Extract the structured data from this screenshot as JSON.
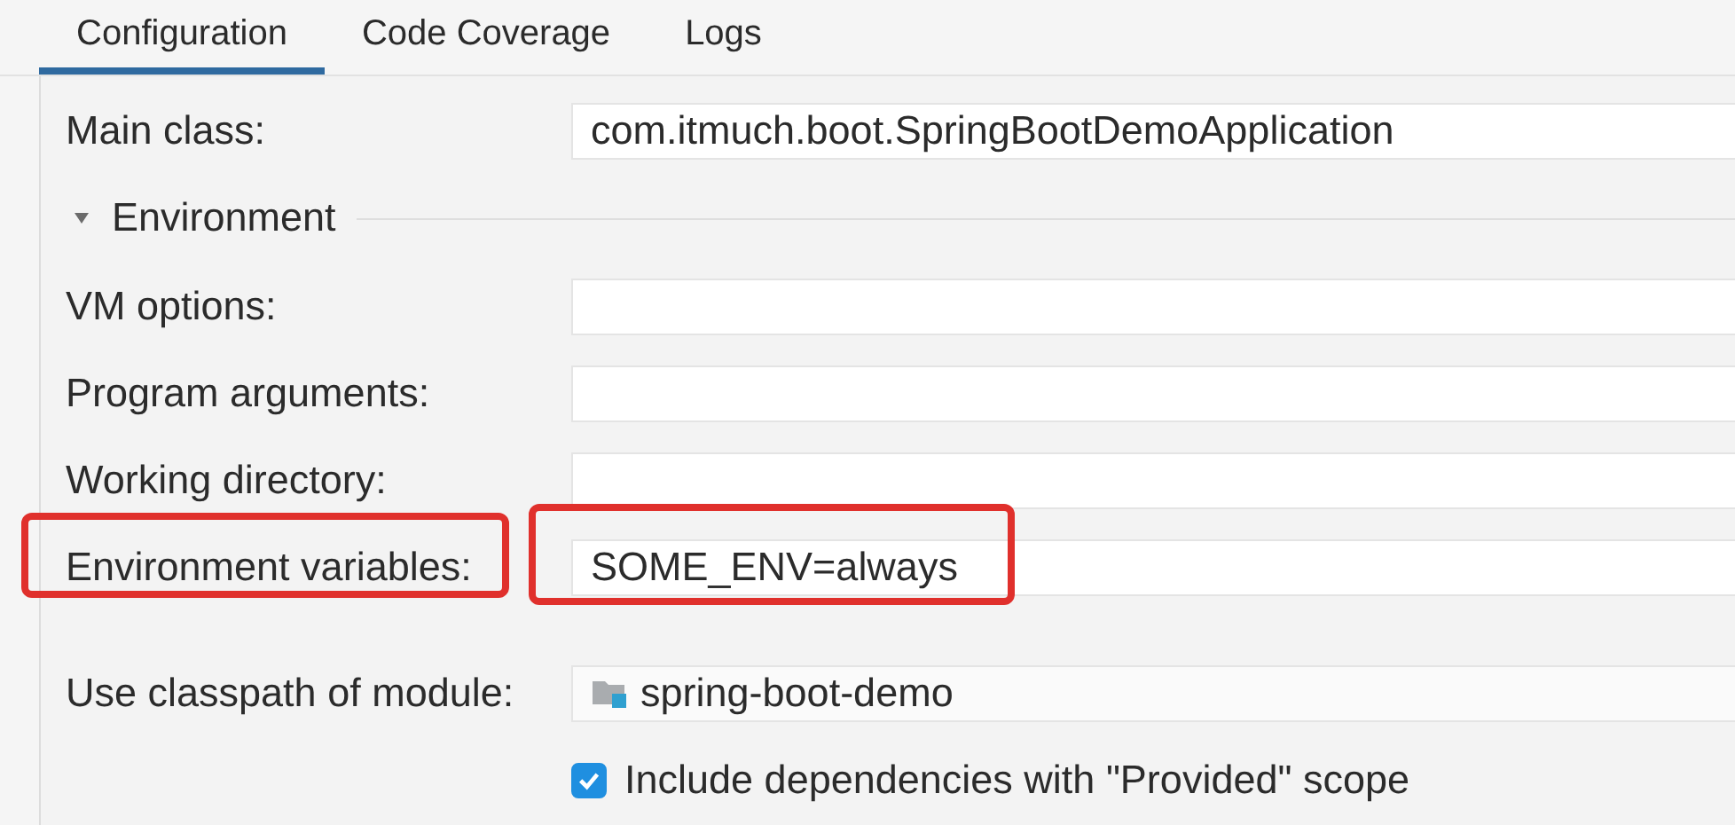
{
  "tabs": [
    {
      "label": "Configuration",
      "selected": true
    },
    {
      "label": "Code Coverage",
      "selected": false
    },
    {
      "label": "Logs",
      "selected": false
    }
  ],
  "rows": [
    {
      "kind": "field",
      "label": "Main class:",
      "value": "com.itmuch.boot.SpringBootDemoApplication",
      "highlighted": false
    },
    {
      "kind": "section",
      "label": "Environment",
      "expanded": true
    },
    {
      "kind": "field",
      "label": "VM options:",
      "highlighted": false
    },
    {
      "kind": "field",
      "label": "Program arguments:",
      "highlighted": false
    },
    {
      "kind": "field",
      "label": "Working directory:",
      "highlighted": false
    },
    {
      "kind": "field",
      "label": "Environment variables:",
      "value": "SOME_ENV=always",
      "highlighted": true
    },
    {
      "kind": "module",
      "label": "Use classpath of module:",
      "value": "spring-boot-demo"
    },
    {
      "kind": "checkbox",
      "label": "Include dependencies with \"Provided\" scope",
      "checked": true
    }
  ]
}
